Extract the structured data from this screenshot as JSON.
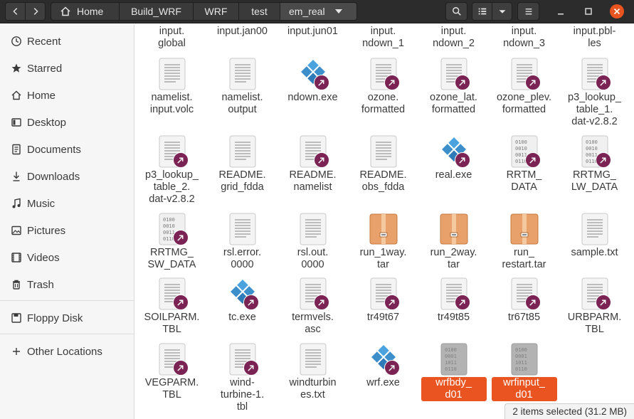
{
  "toolbar": {
    "back_icon": "chevron-left-icon",
    "forward_icon": "chevron-right-icon",
    "breadcrumbs": [
      "Home",
      "Build_WRF",
      "WRF",
      "test",
      "em_real"
    ],
    "search_icon": "search-icon",
    "view_icon": "list-view-icon",
    "menu_icon": "hamburger-menu-icon"
  },
  "sidebar": {
    "items": [
      {
        "label": "Recent",
        "icon": "clock-icon"
      },
      {
        "label": "Starred",
        "icon": "star-icon"
      },
      {
        "label": "Home",
        "icon": "home-icon"
      },
      {
        "label": "Desktop",
        "icon": "desktop-icon"
      },
      {
        "label": "Documents",
        "icon": "document-icon"
      },
      {
        "label": "Downloads",
        "icon": "download-icon"
      },
      {
        "label": "Music",
        "icon": "music-icon"
      },
      {
        "label": "Pictures",
        "icon": "picture-icon"
      },
      {
        "label": "Videos",
        "icon": "video-icon"
      },
      {
        "label": "Trash",
        "icon": "trash-icon"
      },
      {
        "label": "Floppy Disk",
        "icon": "floppy-icon"
      },
      {
        "label": "Other Locations",
        "icon": "plus-icon"
      }
    ]
  },
  "files": [
    {
      "name": "input.\nglobal",
      "type": "text"
    },
    {
      "name": "input.jan00",
      "type": "text"
    },
    {
      "name": "input.jun01",
      "type": "text"
    },
    {
      "name": "input.\nndown_1",
      "type": "text"
    },
    {
      "name": "input.\nndown_2",
      "type": "text"
    },
    {
      "name": "input.\nndown_3",
      "type": "text"
    },
    {
      "name": "input.pbl-\nles",
      "type": "text"
    },
    {
      "name": "namelist.\ninput.volc",
      "type": "text"
    },
    {
      "name": "namelist.\noutput",
      "type": "text"
    },
    {
      "name": "ndown.exe",
      "type": "exe",
      "link": true
    },
    {
      "name": "ozone.\nformatted",
      "type": "text",
      "link": true
    },
    {
      "name": "ozone_lat.\nformatted",
      "type": "text",
      "link": true
    },
    {
      "name": "ozone_plev.\nformatted",
      "type": "text",
      "link": true
    },
    {
      "name": "p3_lookup_\ntable_1.\ndat-v2.8.2",
      "type": "text",
      "link": true
    },
    {
      "name": "p3_lookup_\ntable_2.\ndat-v2.8.2",
      "type": "text",
      "link": true
    },
    {
      "name": "README.\ngrid_fdda",
      "type": "text"
    },
    {
      "name": "README.\nnamelist",
      "type": "text",
      "link": true
    },
    {
      "name": "README.\nobs_fdda",
      "type": "text"
    },
    {
      "name": "real.exe",
      "type": "exe",
      "link": true
    },
    {
      "name": "RRTM_\nDATA",
      "type": "binary",
      "link": true
    },
    {
      "name": "RRTMG_\nLW_DATA",
      "type": "binary",
      "link": true
    },
    {
      "name": "RRTMG_\nSW_DATA",
      "type": "binary",
      "link": true
    },
    {
      "name": "rsl.error.\n0000",
      "type": "text"
    },
    {
      "name": "rsl.out.\n0000",
      "type": "text"
    },
    {
      "name": "run_1way.\ntar",
      "type": "archive"
    },
    {
      "name": "run_2way.\ntar",
      "type": "archive"
    },
    {
      "name": "run_\nrestart.tar",
      "type": "archive"
    },
    {
      "name": "sample.txt",
      "type": "text"
    },
    {
      "name": "SOILPARM.\nTBL",
      "type": "text",
      "link": true
    },
    {
      "name": "tc.exe",
      "type": "exe",
      "link": true
    },
    {
      "name": "termvels.\nasc",
      "type": "text",
      "link": true
    },
    {
      "name": "tr49t67",
      "type": "text",
      "link": true
    },
    {
      "name": "tr49t85",
      "type": "text",
      "link": true
    },
    {
      "name": "tr67t85",
      "type": "text",
      "link": true
    },
    {
      "name": "URBPARM.\nTBL",
      "type": "text",
      "link": true
    },
    {
      "name": "VEGPARM.\nTBL",
      "type": "text",
      "link": true
    },
    {
      "name": "wind-\nturbine-1.\ntbl",
      "type": "text",
      "link": true
    },
    {
      "name": "windturbin\nes.txt",
      "type": "text"
    },
    {
      "name": "wrf.exe",
      "type": "exe",
      "link": true
    },
    {
      "name": "wrfbdy_\nd01",
      "type": "binary-gray",
      "selected": true
    },
    {
      "name": "wrfinput_\nd01",
      "type": "binary-gray",
      "selected": true
    }
  ],
  "status": {
    "text": "2 items selected  (31.2 MB)"
  },
  "colors": {
    "accent": "#e95420",
    "link_badge": "#7a2354",
    "header": "#2c2c2c"
  }
}
